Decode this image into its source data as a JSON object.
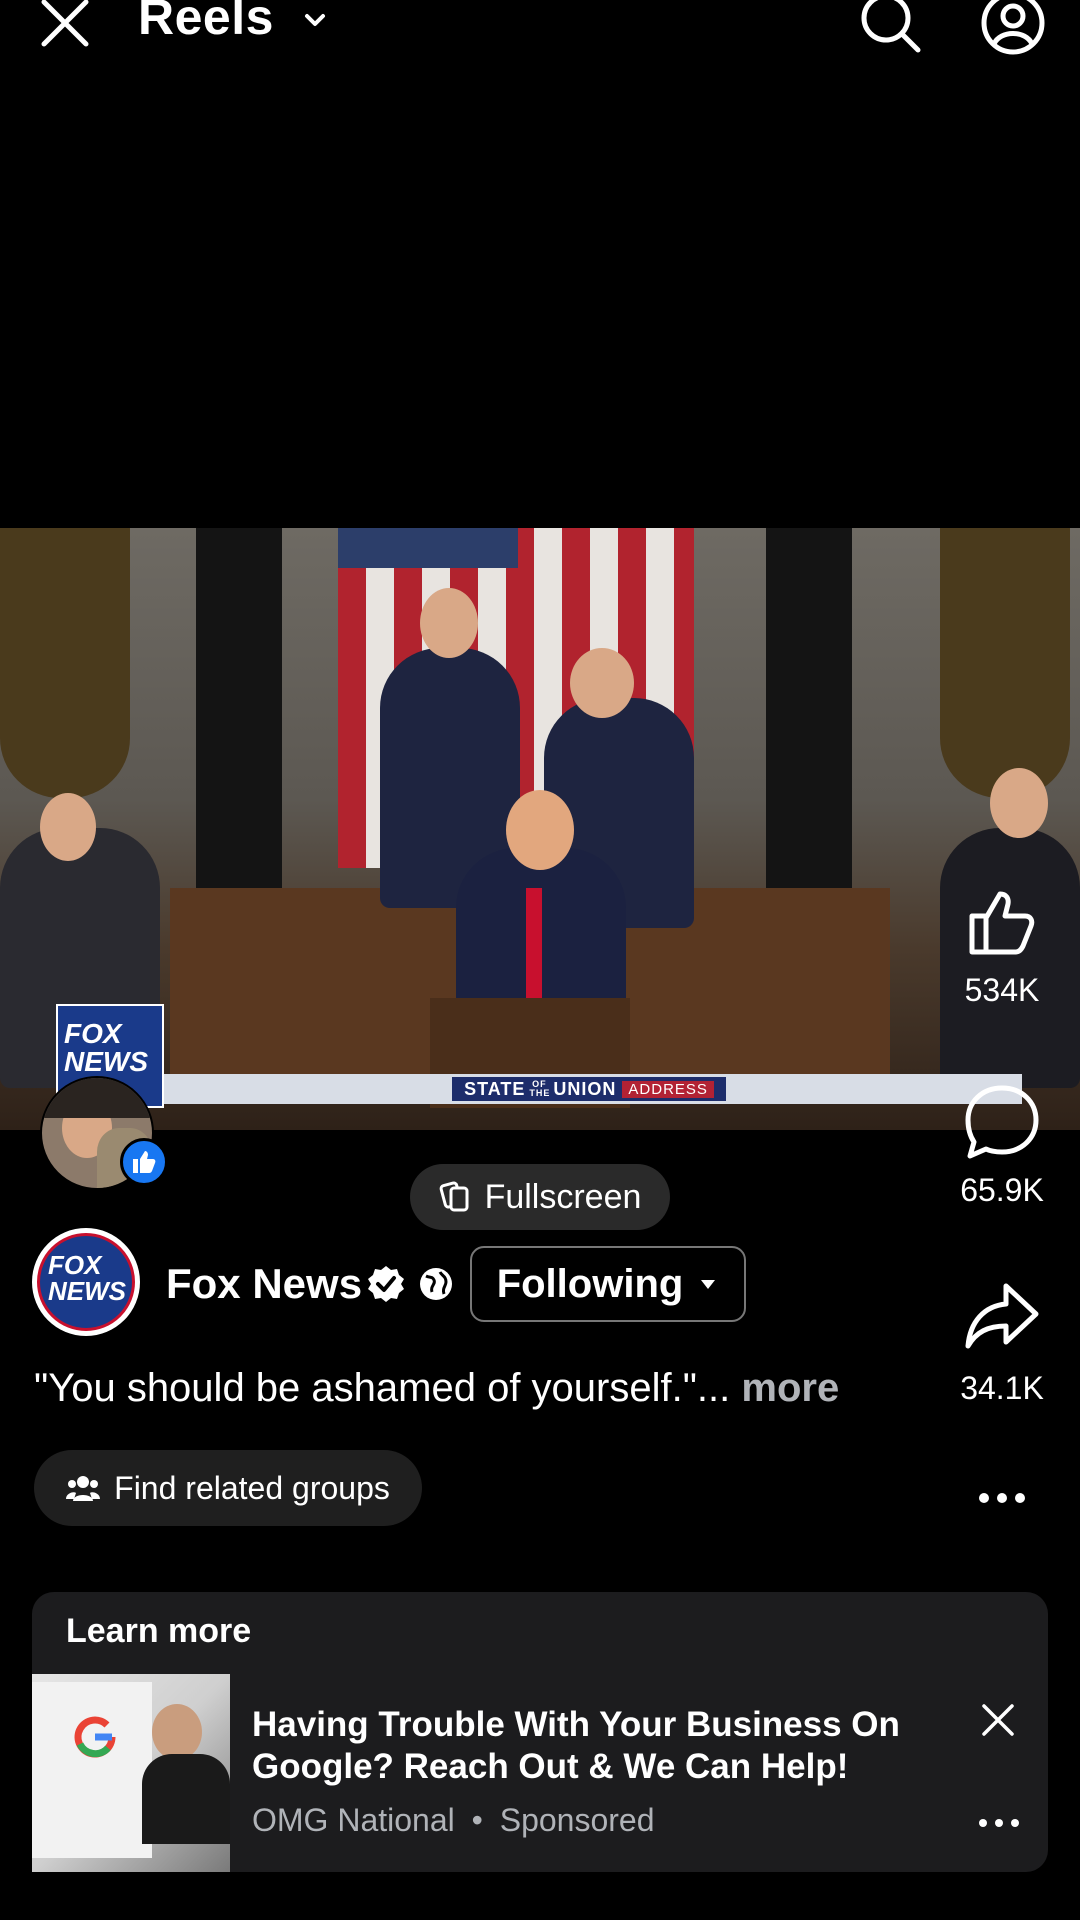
{
  "header": {
    "title": "Reels",
    "close_icon": "close-icon",
    "search_icon": "search-icon",
    "profile_icon": "profile-icon"
  },
  "video": {
    "bug_text": "FOX NEWS",
    "lower_third": {
      "main": "STATE",
      "of_the": "OF THE",
      "union": "UNION",
      "address": "ADDRESS"
    }
  },
  "actions": {
    "likes": "534K",
    "comments": "65.9K",
    "shares": "34.1K"
  },
  "fullscreen_label": "Fullscreen",
  "page": {
    "name": "Fox News",
    "follow_state": "Following",
    "avatar_text": "FOX NEWS"
  },
  "caption": {
    "text": "\"You should be ashamed of yourself.\"...",
    "more": "more"
  },
  "groups_label": "Find related groups",
  "ad": {
    "header": "Learn more",
    "title": "Having Trouble With Your Business On Google? Reach Out & We Can Help!",
    "advertiser": "OMG National",
    "separator": "•",
    "sponsored": "Sponsored"
  }
}
